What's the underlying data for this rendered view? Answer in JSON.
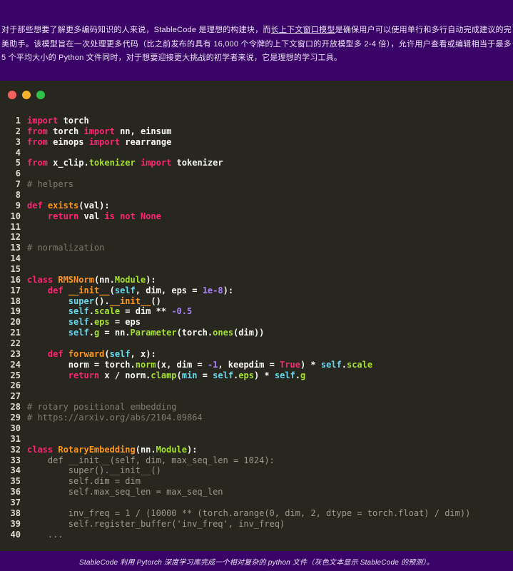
{
  "top_banner": {
    "background": "#3a0368",
    "text_before_link": "对于那些想要了解更多编码知识的人来说，StableCode 是理想的构建块，而",
    "link_text": "长上下文窗口模型",
    "text_after_link": "是确保用户可以使用单行和多行自动完成建议的完美助手。该模型旨在一次处理更多代码（比之前发布的具有 16,000 个令牌的上下文窗口的开放模型多 2-4 倍），允许用户查看或编辑相当于最多 5 个平均大小的 Python 文件同时，对于想要迎接更大挑战的初学者来说，它是理想的学习工具。"
  },
  "window": {
    "background": "#27271f",
    "traffic_lights": [
      {
        "name": "close-button",
        "color": "#f4615e"
      },
      {
        "name": "minimize-button",
        "color": "#f5b02d"
      },
      {
        "name": "maximize-button",
        "color": "#2fc149"
      }
    ]
  },
  "code": {
    "token_colors": {
      "keyword": "#f92672",
      "function_name": "#fd971f",
      "method_attr": "#a6e22e",
      "builtin_self": "#66d9ef",
      "number": "#ae81ff",
      "comment": "#7c7c70",
      "ghost_suggestion": "#9a9a8e",
      "plain": "#f8f8f2",
      "line_number": "#deded4"
    },
    "lines": [
      {
        "n": 1,
        "t": [
          [
            "kw",
            "import"
          ],
          [
            "pl",
            " torch"
          ]
        ]
      },
      {
        "n": 2,
        "t": [
          [
            "kw",
            "from"
          ],
          [
            "pl",
            " torch "
          ],
          [
            "kw",
            "import"
          ],
          [
            "pl",
            " nn, einsum"
          ]
        ]
      },
      {
        "n": 3,
        "t": [
          [
            "kw",
            "from"
          ],
          [
            "pl",
            " einops "
          ],
          [
            "kw",
            "import"
          ],
          [
            "pl",
            " rearrange"
          ]
        ]
      },
      {
        "n": 4,
        "t": []
      },
      {
        "n": 5,
        "t": [
          [
            "kw",
            "from"
          ],
          [
            "pl",
            " x_clip."
          ],
          [
            "mt",
            "tokenizer"
          ],
          [
            "pl",
            " "
          ],
          [
            "kw",
            "import"
          ],
          [
            "pl",
            " tokenizer"
          ]
        ]
      },
      {
        "n": 6,
        "t": []
      },
      {
        "n": 7,
        "t": [
          [
            "cm",
            "# helpers"
          ]
        ]
      },
      {
        "n": 8,
        "t": []
      },
      {
        "n": 9,
        "t": [
          [
            "kw",
            "def"
          ],
          [
            "pl",
            " "
          ],
          [
            "fn",
            "exists"
          ],
          [
            "pl",
            "(val):"
          ]
        ]
      },
      {
        "n": 10,
        "t": [
          [
            "pl",
            "    "
          ],
          [
            "kw",
            "return"
          ],
          [
            "pl",
            " val "
          ],
          [
            "kw",
            "is"
          ],
          [
            "pl",
            " "
          ],
          [
            "kw",
            "not"
          ],
          [
            "pl",
            " "
          ],
          [
            "kw",
            "None"
          ]
        ]
      },
      {
        "n": 11,
        "t": []
      },
      {
        "n": 12,
        "t": []
      },
      {
        "n": 13,
        "t": [
          [
            "cm",
            "# normalization"
          ]
        ]
      },
      {
        "n": 14,
        "t": []
      },
      {
        "n": 15,
        "t": []
      },
      {
        "n": 16,
        "t": [
          [
            "kw",
            "class"
          ],
          [
            "pl",
            " "
          ],
          [
            "fn",
            "RMSNorm"
          ],
          [
            "pl",
            "(nn."
          ],
          [
            "mt",
            "Module"
          ],
          [
            "pl",
            "):"
          ]
        ]
      },
      {
        "n": 17,
        "t": [
          [
            "pl",
            "    "
          ],
          [
            "kw",
            "def"
          ],
          [
            "pl",
            " "
          ],
          [
            "fn",
            "__init__"
          ],
          [
            "pl",
            "("
          ],
          [
            "bi",
            "self"
          ],
          [
            "pl",
            ", dim, eps = "
          ],
          [
            "nm",
            "1e-8"
          ],
          [
            "pl",
            "):"
          ]
        ]
      },
      {
        "n": 18,
        "t": [
          [
            "pl",
            "        "
          ],
          [
            "bi",
            "super"
          ],
          [
            "pl",
            "()."
          ],
          [
            "fn",
            "__init__"
          ],
          [
            "pl",
            "()"
          ]
        ]
      },
      {
        "n": 19,
        "t": [
          [
            "pl",
            "        "
          ],
          [
            "bi",
            "self"
          ],
          [
            "pl",
            "."
          ],
          [
            "mt",
            "scale"
          ],
          [
            "pl",
            " = dim ** "
          ],
          [
            "nm",
            "-0.5"
          ]
        ]
      },
      {
        "n": 20,
        "t": [
          [
            "pl",
            "        "
          ],
          [
            "bi",
            "self"
          ],
          [
            "pl",
            "."
          ],
          [
            "mt",
            "eps"
          ],
          [
            "pl",
            " = eps"
          ]
        ]
      },
      {
        "n": 21,
        "t": [
          [
            "pl",
            "        "
          ],
          [
            "bi",
            "self"
          ],
          [
            "pl",
            "."
          ],
          [
            "mt",
            "g"
          ],
          [
            "pl",
            " = nn."
          ],
          [
            "mt",
            "Parameter"
          ],
          [
            "pl",
            "(torch."
          ],
          [
            "mt",
            "ones"
          ],
          [
            "pl",
            "(dim))"
          ]
        ]
      },
      {
        "n": 22,
        "t": []
      },
      {
        "n": 23,
        "t": [
          [
            "pl",
            "    "
          ],
          [
            "kw",
            "def"
          ],
          [
            "pl",
            " "
          ],
          [
            "fn",
            "forward"
          ],
          [
            "pl",
            "("
          ],
          [
            "bi",
            "self"
          ],
          [
            "pl",
            ", x):"
          ]
        ]
      },
      {
        "n": 24,
        "t": [
          [
            "pl",
            "        norm = torch."
          ],
          [
            "mt",
            "norm"
          ],
          [
            "pl",
            "(x, dim = "
          ],
          [
            "nm",
            "-1"
          ],
          [
            "pl",
            ", keepdim = "
          ],
          [
            "kw",
            "True"
          ],
          [
            "pl",
            ") * "
          ],
          [
            "bi",
            "self"
          ],
          [
            "pl",
            "."
          ],
          [
            "mt",
            "scale"
          ]
        ]
      },
      {
        "n": 25,
        "t": [
          [
            "pl",
            "        "
          ],
          [
            "kw",
            "return"
          ],
          [
            "pl",
            " x / norm."
          ],
          [
            "mt",
            "clamp"
          ],
          [
            "pl",
            "("
          ],
          [
            "bi",
            "min"
          ],
          [
            "pl",
            " = "
          ],
          [
            "bi",
            "self"
          ],
          [
            "pl",
            "."
          ],
          [
            "mt",
            "eps"
          ],
          [
            "pl",
            ") * "
          ],
          [
            "bi",
            "self"
          ],
          [
            "pl",
            "."
          ],
          [
            "mt",
            "g"
          ]
        ]
      },
      {
        "n": 26,
        "t": []
      },
      {
        "n": 27,
        "t": []
      },
      {
        "n": 28,
        "t": [
          [
            "cm",
            "# rotary positional embedding"
          ]
        ]
      },
      {
        "n": 29,
        "t": [
          [
            "cm",
            "# https://arxiv.org/abs/2104.09864"
          ]
        ]
      },
      {
        "n": 30,
        "t": []
      },
      {
        "n": 31,
        "t": []
      },
      {
        "n": 32,
        "t": [
          [
            "kw",
            "class"
          ],
          [
            "pl",
            " "
          ],
          [
            "fn",
            "RotaryEmbedding"
          ],
          [
            "pl",
            "(nn."
          ],
          [
            "mt",
            "Module"
          ],
          [
            "pl",
            "):"
          ]
        ]
      },
      {
        "n": 33,
        "t": [
          [
            "gh",
            "    def __init__(self, dim, max_seq_len = 1024):"
          ]
        ]
      },
      {
        "n": 34,
        "t": [
          [
            "gh",
            "        super().__init__()"
          ]
        ]
      },
      {
        "n": 35,
        "t": [
          [
            "gh",
            "        self.dim = dim"
          ]
        ]
      },
      {
        "n": 36,
        "t": [
          [
            "gh",
            "        self.max_seq_len = max_seq_len"
          ]
        ]
      },
      {
        "n": 37,
        "t": []
      },
      {
        "n": 38,
        "t": [
          [
            "gh",
            "        inv_freq = 1 / (10000 ** (torch.arange(0, dim, 2, dtype = torch.float) / dim))"
          ]
        ]
      },
      {
        "n": 39,
        "t": [
          [
            "gh",
            "        self.register_buffer('inv_freq', inv_freq)"
          ]
        ]
      },
      {
        "n": 40,
        "t": [
          [
            "gh",
            "    ..."
          ]
        ]
      }
    ]
  },
  "bottom_banner": {
    "background": "#3a0368",
    "caption": "StableCode 利用 Pytorch 深度学习库完成一个相对复杂的 python 文件（灰色文本显示 StableCode 的预测）。"
  }
}
